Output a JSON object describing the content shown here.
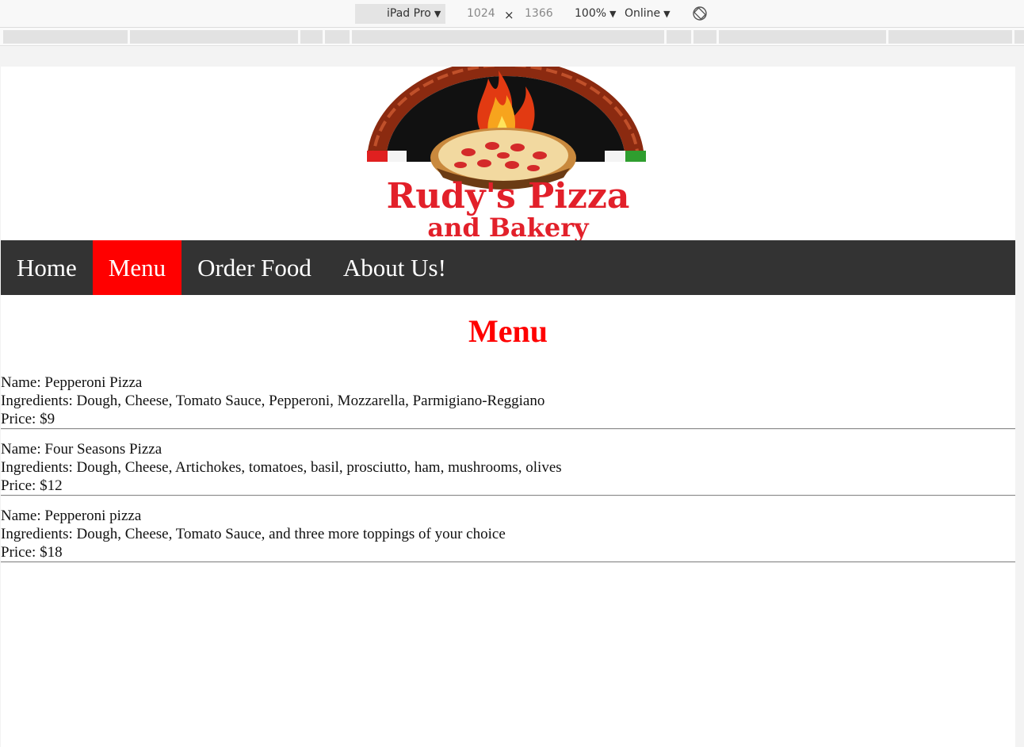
{
  "devtools": {
    "device": "iPad Pro",
    "width": "1024",
    "times": "×",
    "height": "1366",
    "zoom": "100%",
    "network": "Online",
    "dropdown_arrow": "▼"
  },
  "site": {
    "logo": {
      "line1": "Rudy's Pizza",
      "line2": "and Bakery"
    },
    "nav": [
      {
        "label": "Home",
        "active": false
      },
      {
        "label": "Menu",
        "active": true
      },
      {
        "label": "Order Food",
        "active": false
      },
      {
        "label": "About Us!",
        "active": false
      }
    ],
    "heading": "Menu",
    "items": [
      {
        "name": "Name: Pepperoni Pizza",
        "ingredients": "Ingredients: Dough, Cheese, Tomato Sauce, Pepperoni, Mozzarella, Parmigiano-Reggiano",
        "price": "Price: $9"
      },
      {
        "name": "Name: Four Seasons Pizza",
        "ingredients": "Ingredients: Dough, Cheese, Artichokes, tomatoes, basil, prosciutto, ham, mushrooms, olives",
        "price": "Price: $12"
      },
      {
        "name": "Name: Pepperoni pizza",
        "ingredients": "Ingredients: Dough, Cheese, Tomato Sauce, and three more toppings of your choice",
        "price": "Price: $18"
      }
    ]
  },
  "colors": {
    "nav_bg": "#333333",
    "accent": "#ff0000"
  }
}
